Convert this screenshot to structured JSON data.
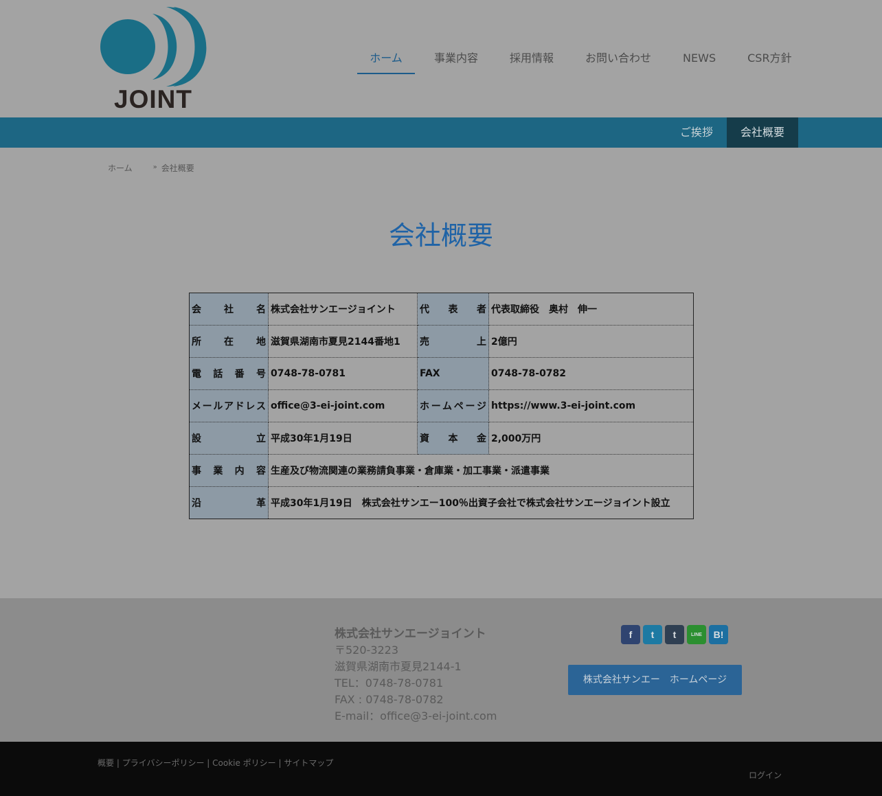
{
  "logo": {
    "text": "JOINT",
    "color": "#1a6e86"
  },
  "nav": {
    "items": [
      "ホーム",
      "事業内容",
      "採用情報",
      "お問い合わせ",
      "NEWS",
      "CSR方針"
    ],
    "active_index": 0
  },
  "subnav": {
    "items": [
      "ご挨拶",
      "会社概要"
    ],
    "active_index": 1
  },
  "breadcrumb": {
    "home": "ホーム",
    "sep": "»",
    "current": "会社概要"
  },
  "page_title": "会社概要",
  "table": {
    "r1": {
      "k1": "会社名",
      "v1": "株式会社サンエージョイント",
      "k2": "代表者",
      "v2": "代表取締役　奥村　伸一"
    },
    "r2": {
      "k1": "所在地",
      "v1": "滋賀県湖南市夏見2144番地1",
      "k2": "売上",
      "v2": "2億円"
    },
    "r3": {
      "k1": "電話番号",
      "v1": "0748-78-0781",
      "k2": "FAX",
      "v2": "0748-78-0782"
    },
    "r4": {
      "k1": "メールアドレス",
      "v1": "office@3-ei-joint.com",
      "k2": "ホームページ",
      "v2": "https://www.3-ei-joint.com"
    },
    "r5": {
      "k1": "設立",
      "v1": "平成30年1月19日",
      "k2": "資本金",
      "v2": "2,000万円"
    },
    "r6": {
      "k1": "事業内容",
      "v1": "生産及び物流関連の業務請負事業・倉庫業・加工事業・派遣事業"
    },
    "r7": {
      "k1": "沿革",
      "v1": "平成30年1月19日　株式会社サンエー100％出資子会社で株式会社サンエージョイント設立"
    }
  },
  "footer": {
    "company": "株式会社サンエージョイント",
    "zip": "〒520-3223",
    "address": "滋賀県湖南市夏見2144-1",
    "tel": "TEL：0748-78-0781",
    "fax": "FAX : 0748-78-0782",
    "email": "E-mail：office@3-ei-joint.com",
    "social": {
      "fb": "f",
      "tw": "t",
      "tb": "t",
      "ln": "LINE",
      "hb": "B!"
    },
    "home_button": "株式会社サンエー　ホームページ"
  },
  "bottom": {
    "links": [
      "概要",
      "プライバシーポリシー",
      "Cookie ポリシー",
      "サイトマップ"
    ],
    "sep": " | ",
    "login": "ログイン"
  }
}
